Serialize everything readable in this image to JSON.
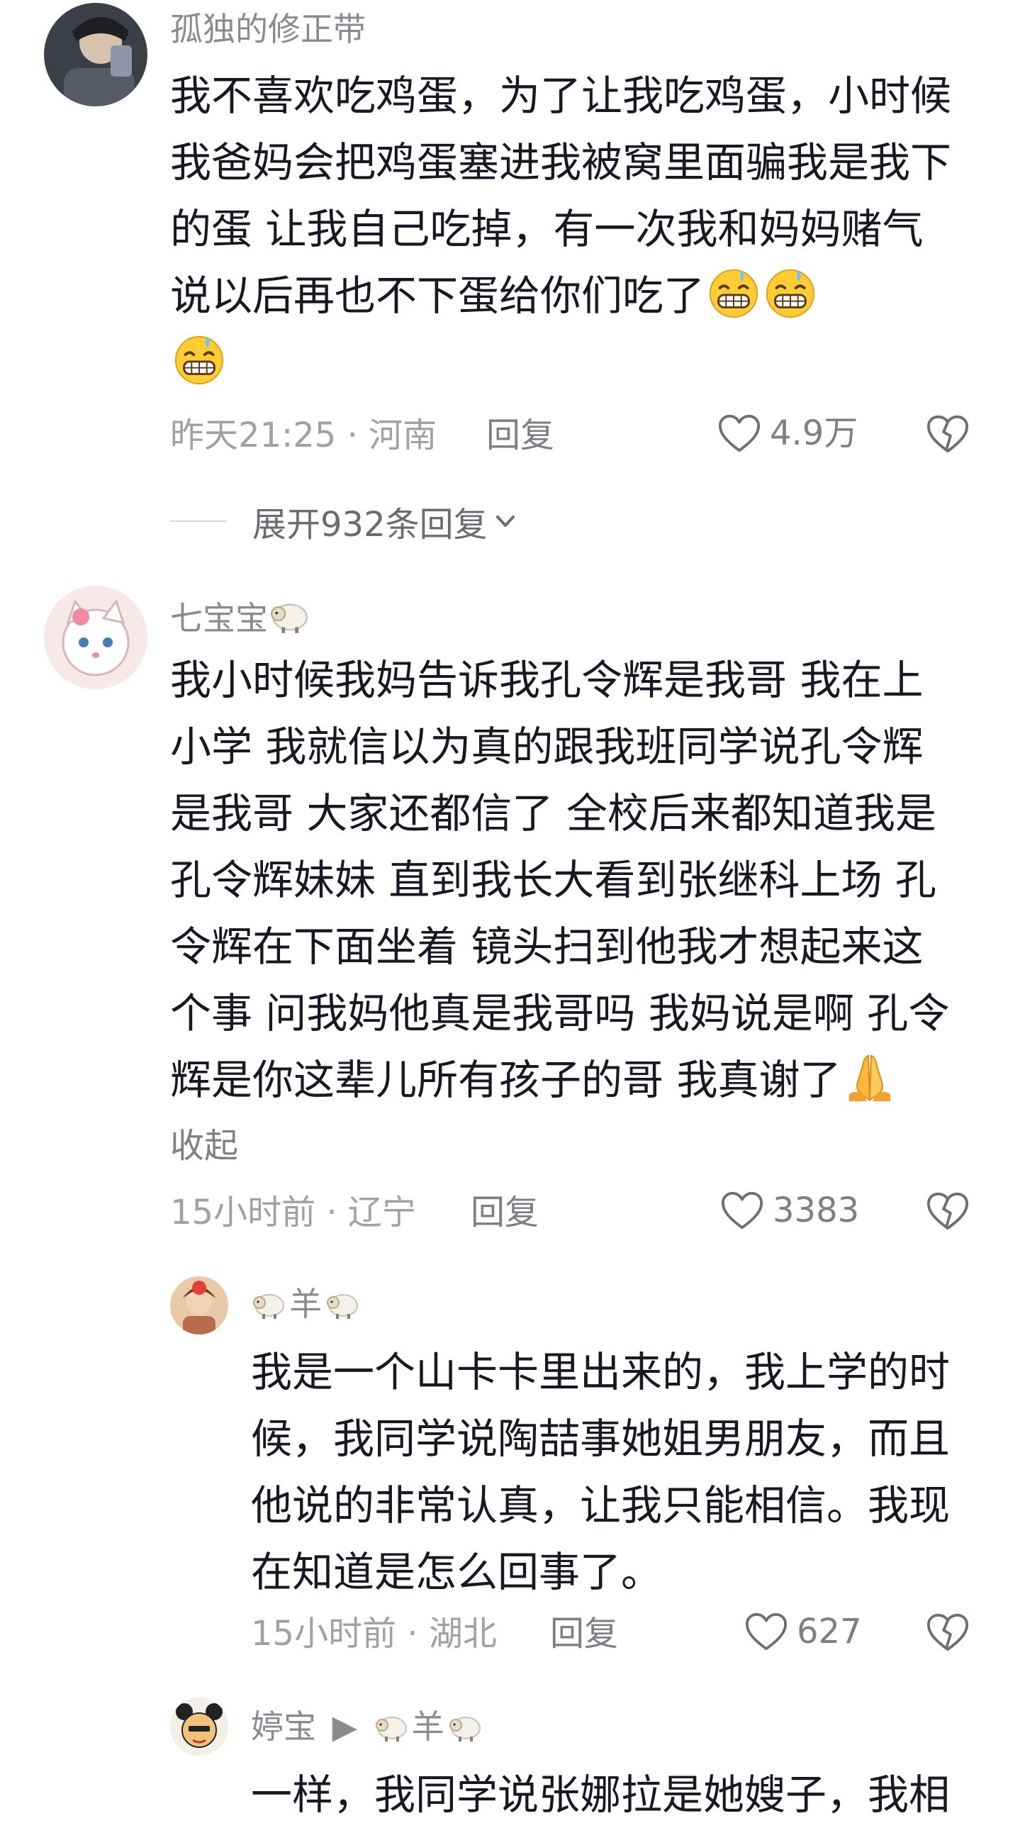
{
  "comments": [
    {
      "username": "孤独的修正带",
      "text": "我不喜欢吃鸡蛋，为了让我吃鸡蛋，小时候我爸妈会把鸡蛋塞进我被窝里面骗我是我下的蛋 让我自己吃掉，有一次我和妈妈赌气说以后再也不下蛋给你们吃了",
      "emoji": "grimacing-sweat-emoji x3",
      "time": "昨天21:25",
      "location": "河南",
      "reply_label": "回复",
      "likes": "4.9万",
      "expand_label": "展开932条回复"
    },
    {
      "username": "七宝宝",
      "text": "我小时候我妈告诉我孔令辉是我哥 我在上小学 我就信以为真的跟我班同学说孔令辉是我哥 大家还都信了 全校后来都知道我是孔令辉妹妹 直到我长大看到张继科上场 孔令辉在下面坐着 镜头扫到他我才想起来这个事 问我妈他真是我哥吗 我妈说是啊 孔令辉是你这辈儿所有孩子的哥 我真谢了",
      "emoji": "folded-hands-emoji",
      "collapse_label": "收起",
      "time": "15小时前",
      "location": "辽宁",
      "reply_label": "回复",
      "likes": "3383"
    }
  ],
  "replies": [
    {
      "username": "羊",
      "text": "我是一个山卡卡里出来的，我上学的时候，我同学说陶喆事她姐男朋友，而且他说的非常认真，让我只能相信。我现在知道是怎么回事了。",
      "time": "15小时前",
      "location": "湖北",
      "reply_label": "回复",
      "likes": "627"
    },
    {
      "username": "婷宝",
      "reply_to": "羊",
      "text": "一样，我同学说张娜拉是她嫂子，我相"
    }
  ],
  "separator": "·",
  "colors": {
    "text": "#161823",
    "meta": "#a0a1a6",
    "username": "#8a8b91"
  }
}
